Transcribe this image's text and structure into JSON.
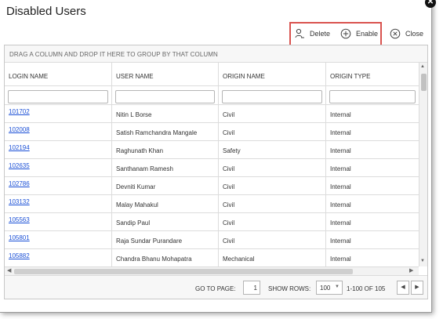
{
  "dialog": {
    "title": "Disabled Users"
  },
  "toolbar": {
    "delete_label": "Delete",
    "enable_label": "Enable",
    "close_label": "Close"
  },
  "grid": {
    "group_hint": "DRAG A COLUMN AND DROP IT HERE TO GROUP BY THAT COLUMN",
    "columns": [
      "LOGIN NAME",
      "USER NAME",
      "ORIGIN NAME",
      "ORIGIN TYPE"
    ],
    "rows": [
      {
        "login": "101702",
        "user": "Nitin L Borse",
        "origin": "Civil",
        "type": "Internal"
      },
      {
        "login": "102008",
        "user": "Satish Ramchandra Mangale",
        "origin": "Civil",
        "type": "Internal"
      },
      {
        "login": "102194",
        "user": "Raghunath Khan",
        "origin": "Safety",
        "type": "Internal"
      },
      {
        "login": "102635",
        "user": "Santhanam Ramesh",
        "origin": "Civil",
        "type": "Internal"
      },
      {
        "login": "102786",
        "user": "Devniti Kumar",
        "origin": "Civil",
        "type": "Internal"
      },
      {
        "login": "103132",
        "user": "Malay Mahakul",
        "origin": "Civil",
        "type": "Internal"
      },
      {
        "login": "105563",
        "user": "Sandip Paul",
        "origin": "Civil",
        "type": "Internal"
      },
      {
        "login": "105801",
        "user": "Raja Sundar Purandare",
        "origin": "Civil",
        "type": "Internal"
      },
      {
        "login": "105882",
        "user": "Chandra Bhanu Mohapatra",
        "origin": "Mechanical",
        "type": "Internal"
      }
    ]
  },
  "footer": {
    "go_to_page_label": "GO TO PAGE:",
    "page_value": "1",
    "show_rows_label": "SHOW ROWS:",
    "rows_value": "100",
    "range_label": "1-100 OF 105"
  },
  "colors": {
    "highlight": "#d9534f",
    "link": "#1a4fd6"
  },
  "icons": [
    "close-icon",
    "delete-user-icon",
    "plus-circle-icon",
    "x-circle-icon",
    "chevron-left-icon",
    "chevron-right-icon"
  ]
}
